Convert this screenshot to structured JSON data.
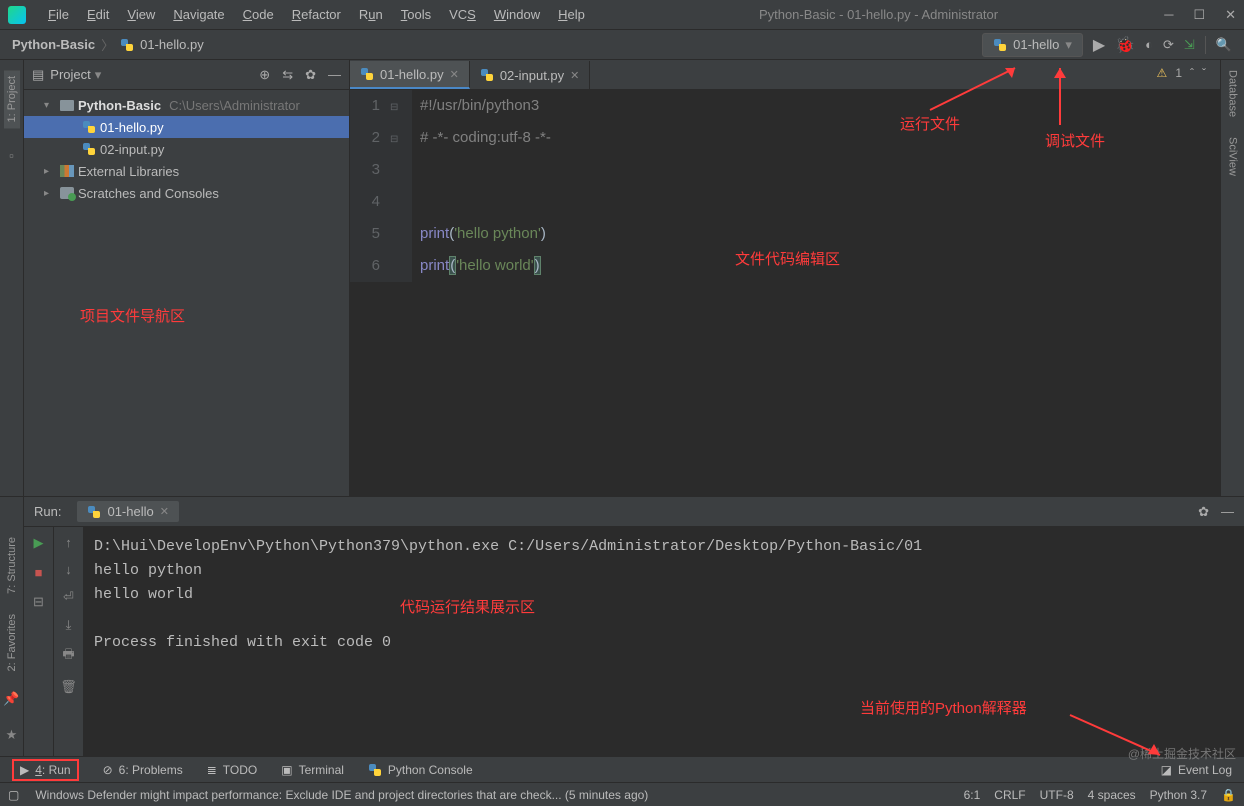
{
  "window": {
    "title": "Python-Basic - 01-hello.py - Administrator"
  },
  "menu": [
    "File",
    "Edit",
    "View",
    "Navigate",
    "Code",
    "Refactor",
    "Run",
    "Tools",
    "VCS",
    "Window",
    "Help"
  ],
  "breadcrumb": {
    "root": "Python-Basic",
    "file": "01-hello.py"
  },
  "runConfig": {
    "name": "01-hello"
  },
  "project": {
    "panelTitle": "Project",
    "rootName": "Python-Basic",
    "rootPath": "C:\\Users\\Administrator",
    "files": [
      "01-hello.py",
      "02-input.py"
    ],
    "externalLibs": "External Libraries",
    "scratches": "Scratches and Consoles"
  },
  "editor": {
    "tabs": [
      {
        "name": "01-hello.py",
        "active": true
      },
      {
        "name": "02-input.py",
        "active": false
      }
    ],
    "warnings": "1",
    "lines": {
      "l1": "#!/usr/bin/python3",
      "l2": "# -*- coding:utf-8 -*-",
      "l5a": "print",
      "l5b": "(",
      "l5c": "'hello python'",
      "l5d": ")",
      "l6a": "print",
      "l6b": "(",
      "l6c": "'hello world'",
      "l6d": ")"
    }
  },
  "run": {
    "title": "Run:",
    "tabName": "01-hello",
    "output": "D:\\Hui\\DevelopEnv\\Python\\Python379\\python.exe C:/Users/Administrator/Desktop/Python-Basic/01\nhello python\nhello world\n\nProcess finished with exit code 0"
  },
  "toolWindows": {
    "run": "4: Run",
    "problems": "6: Problems",
    "todo": "TODO",
    "terminal": "Terminal",
    "pyconsole": "Python Console",
    "eventlog": "Event Log"
  },
  "status": {
    "message": "Windows Defender might impact performance: Exclude IDE and project directories that are check... (5 minutes ago)",
    "pos": "6:1",
    "eol": "CRLF",
    "enc": "UTF-8",
    "indent": "4 spaces",
    "interp": "Python 3.7"
  },
  "leftTabs": {
    "project": "1: Project"
  },
  "bottomLeftTabs": {
    "structure": "7: Structure",
    "favorites": "2: Favorites"
  },
  "rightTabs": {
    "database": "Database",
    "sciview": "SciView"
  },
  "annotations": {
    "navArea": "项目文件导航区",
    "editArea": "文件代码编辑区",
    "runFile": "运行文件",
    "debugFile": "调试文件",
    "outputArea": "代码运行结果展示区",
    "interpreter": "当前使用的Python解释器"
  },
  "watermark": "@稀土掘金技术社区"
}
